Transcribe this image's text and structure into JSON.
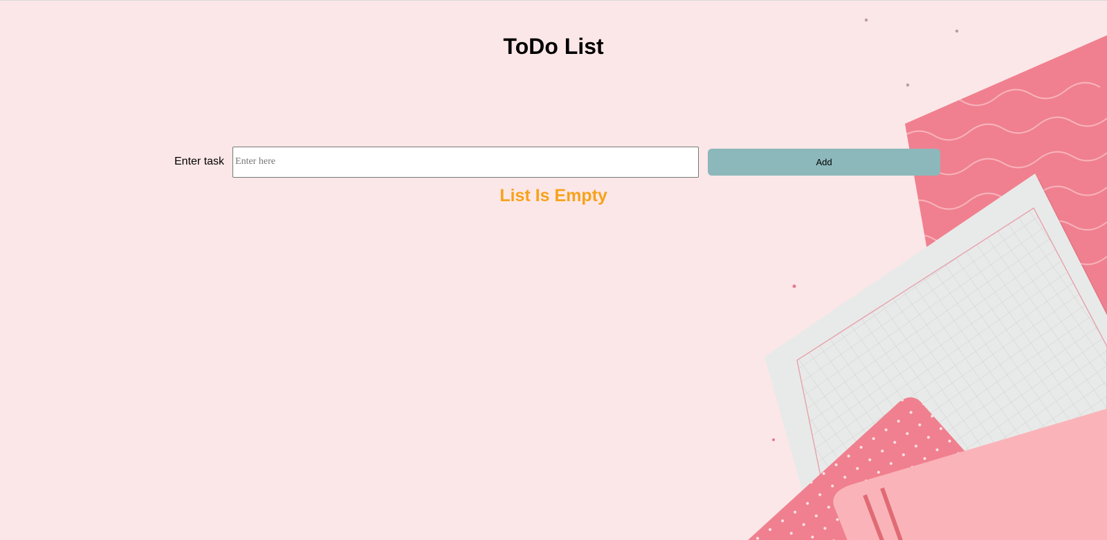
{
  "header": {
    "title": "ToDo List"
  },
  "form": {
    "label": "Enter task",
    "input_value": "",
    "input_placeholder": "Enter here",
    "add_label": "Add"
  },
  "list": {
    "empty_message": "List Is Empty",
    "items": []
  },
  "colors": {
    "background": "#fbe7e8",
    "accent_button": "#8cb8bb",
    "empty_text": "#f7a21b",
    "paper_pink": "#f0808f",
    "paper_white": "#e8eae9"
  }
}
